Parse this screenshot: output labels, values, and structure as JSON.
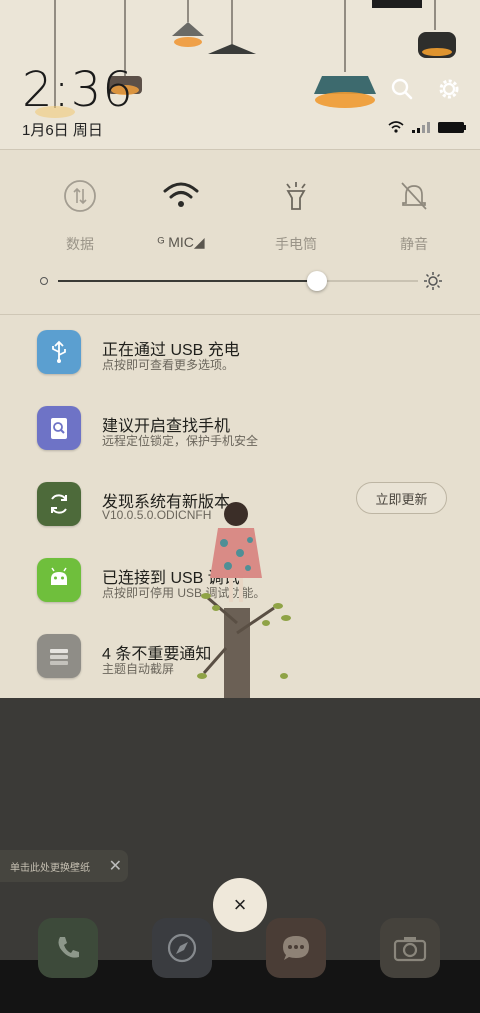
{
  "header": {
    "time": "2:36",
    "date": "1月6日 周日"
  },
  "quick_settings": {
    "tiles": [
      {
        "label": "数据",
        "icon": "data-arrows-icon",
        "active": false
      },
      {
        "label": "ᴳ MIC◢",
        "icon": "wifi-icon",
        "active": true
      },
      {
        "label": "手电筒",
        "icon": "flashlight-icon",
        "active": false
      },
      {
        "label": "静音",
        "icon": "mute-bell-icon",
        "active": false
      }
    ],
    "brightness_level": 0.72
  },
  "notifications": [
    {
      "title": "正在通过 USB 充电",
      "subtitle": "点按即可查看更多选项。",
      "icon": "usb-icon",
      "color": "#5b9fd0"
    },
    {
      "title": "建议开启查找手机",
      "subtitle": "远程定位锁定，保护手机安全",
      "icon": "find-phone-icon",
      "color": "#6e73c6"
    },
    {
      "title": "发现系统有新版本",
      "subtitle": "V10.0.5.0.ODICNFH",
      "icon": "system-update-icon",
      "color": "#4d6a3a",
      "action": "立即更新"
    },
    {
      "title": "已连接到 USB 调试",
      "subtitle": "点按即可停用 USB 调试功能。",
      "icon": "android-icon",
      "color": "#6fbf3c"
    },
    {
      "title": "4 条不重要通知",
      "subtitle": "主题自动截屏",
      "icon": "stacked-notifications-icon",
      "color": "#8f8d87"
    }
  ],
  "wallpaper_toast": {
    "text": "单击此处更换壁纸",
    "close": "✕"
  },
  "close_button": "×",
  "colors": {
    "shade_bg": "#e6dfcf",
    "dim_bg": "#3b3a37"
  }
}
